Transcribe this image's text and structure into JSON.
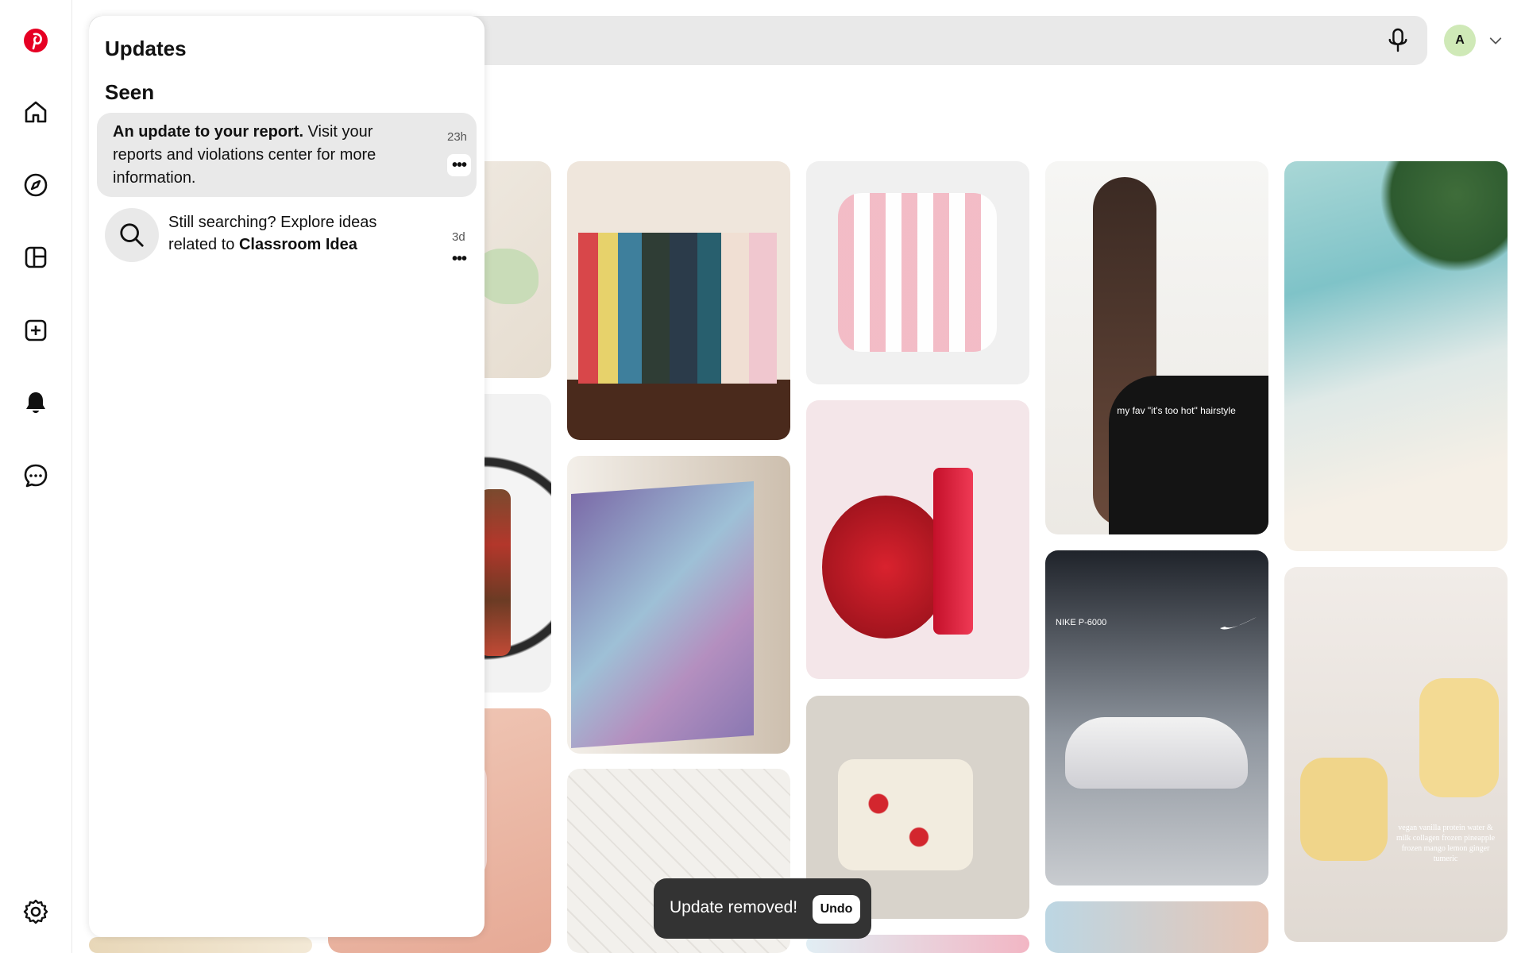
{
  "colors": {
    "brand": "#e60023",
    "surface": "#e9e9e9",
    "avatar_bg": "#cfe9b7",
    "toast_bg": "#333333"
  },
  "nav": {
    "icons": [
      "pinterest-logo-icon",
      "home-icon",
      "explore-icon",
      "boards-icon",
      "create-icon",
      "notifications-icon",
      "messages-icon",
      "settings-icon"
    ]
  },
  "header": {
    "avatar_initial": "A"
  },
  "updates": {
    "title": "Updates",
    "section": "Seen",
    "items": [
      {
        "bold": "An update to your report.",
        "text": " Visit your reports and violations center for more information.",
        "time": "23h",
        "more": "•••"
      },
      {
        "text": "Still searching? Explore ideas related to ",
        "bold": "Classroom Idea",
        "time": "3d",
        "more": "•••"
      }
    ]
  },
  "feed": {
    "pins": [
      {
        "caption": ""
      },
      {
        "caption": ""
      },
      {
        "caption": ""
      },
      {
        "caption": "my fav \"it's too hot\" hairstyle"
      },
      {
        "caption": "NIKE P-6000"
      },
      {
        "caption": "vegan vanilla protein water & milk collagen frozen pineapple frozen mango lemon ginger tumeric"
      }
    ]
  },
  "toast": {
    "message": "Update removed!",
    "undo_label": "Undo"
  }
}
